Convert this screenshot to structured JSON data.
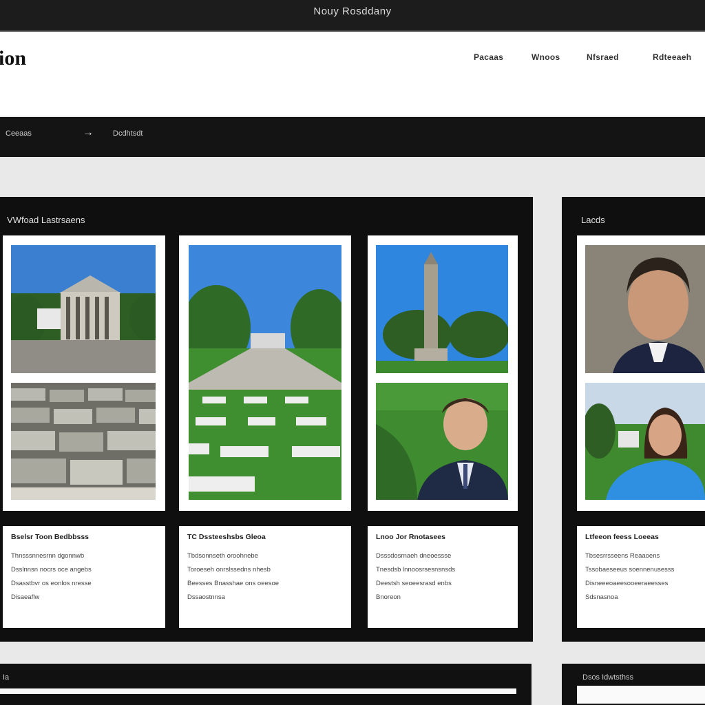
{
  "window": {
    "title": "Nouy Rosddany"
  },
  "header": {
    "logo": "ion",
    "nav": [
      "Pacaas",
      "Wnoos",
      "Nfsraed",
      "Rdteeaeh"
    ]
  },
  "breadcrumb": {
    "first": "Ceeaas",
    "arrow": "→",
    "second": "Dcdhtsdt"
  },
  "gallery": {
    "title": "VWfoad Lastrsaens",
    "cards": [
      {
        "title": "Bselsr Toon Bedbbsss",
        "lines": [
          "Thnsssnnesrnn dgonnwb",
          "Dsslnnsn nocrs oce angebs",
          "Dsasstbvr os eonlos nresse",
          "Disaeaflw"
        ]
      },
      {
        "title": "TC Dssteeshsbs Gleoa",
        "lines": [
          "Tbdsonnseth oroohnebe",
          "Toroeseh onrslssedns nhesb",
          "Beesses Bnasshae ons oeesoe",
          "Dssaostnnsa"
        ]
      },
      {
        "title": "Lnoo Jor Rnotasees",
        "lines": [
          "Dsssdosrnaeh dneoessse",
          "Tnesdsb lnnoosrsesnsnsds",
          "Deestsh seoeesrasd enbs",
          "Bnoreon"
        ]
      }
    ]
  },
  "side": {
    "title": "Lacds",
    "card": {
      "title": "Ltfeeon feess Loeeas",
      "lines": [
        "Tbsesrrsseens Reaaoens",
        "Tssobaeseeus soennenusesss",
        "Disneeeoaeesooeeraeesses",
        "Sdsnasnoa"
      ]
    }
  },
  "footer": {
    "left": "Ia",
    "right": "Dsos Idwtsthss"
  },
  "colors": {
    "dark": "#0f0f0f",
    "sky": "#2f7fd6",
    "grass": "#3f8a2e"
  }
}
